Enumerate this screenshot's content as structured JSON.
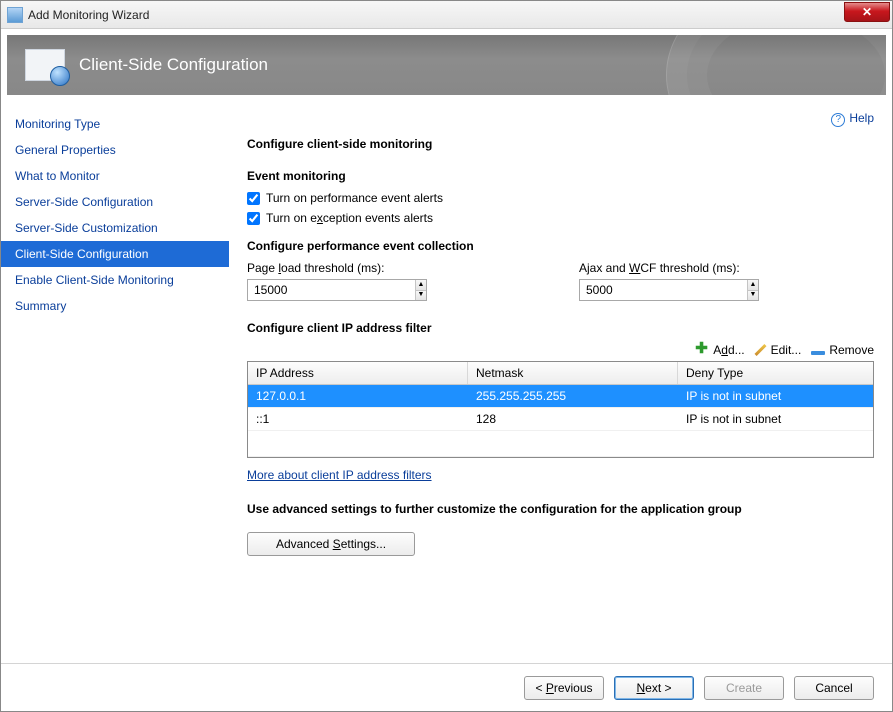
{
  "window": {
    "title": "Add Monitoring Wizard"
  },
  "banner": {
    "caption": "Client-Side Configuration"
  },
  "help": {
    "label": "Help"
  },
  "sidebar": {
    "items": [
      {
        "label": "Monitoring Type"
      },
      {
        "label": "General Properties"
      },
      {
        "label": "What to Monitor"
      },
      {
        "label": "Server-Side Configuration"
      },
      {
        "label": "Server-Side Customization"
      },
      {
        "label": "Client-Side Configuration"
      },
      {
        "label": "Enable Client-Side Monitoring"
      },
      {
        "label": "Summary"
      }
    ],
    "active_index": 5
  },
  "content": {
    "h1": "Configure client-side monitoring",
    "event_heading": "Event monitoring",
    "perf_checkbox": "Turn on performance event alerts",
    "perf_checkbox_checked": true,
    "exc_prefix": "Turn on e",
    "exc_ul": "x",
    "exc_suffix": "ception events alerts",
    "exc_checkbox_checked": true,
    "perf_collection_heading": "Configure performance event collection",
    "page_load_prefix": "Page ",
    "page_load_ul": "l",
    "page_load_suffix": "oad threshold (ms):",
    "page_load_value": "15000",
    "ajax_prefix": "Ajax and ",
    "ajax_ul": "W",
    "ajax_suffix": "CF threshold (ms):",
    "ajax_value": "5000",
    "ipfilter_heading": "Configure client IP address filter",
    "toolbar": {
      "add_ul": "d",
      "add_prefix": "A",
      "add_suffix": "d...",
      "edit": "Edit...",
      "remove": "Remove"
    },
    "table": {
      "cols": [
        "IP Address",
        "Netmask",
        "Deny Type"
      ],
      "rows": [
        {
          "ip": "127.0.0.1",
          "mask": "255.255.255.255",
          "deny": "IP is not in subnet",
          "selected": true
        },
        {
          "ip": "::1",
          "mask": "128",
          "deny": "IP is not in subnet",
          "selected": false
        }
      ]
    },
    "more_link": "More about client IP address filters",
    "adv_heading": "Use advanced settings to further customize the configuration for the application group",
    "adv_btn_prefix": "Advanced ",
    "adv_btn_ul": "S",
    "adv_btn_suffix": "ettings..."
  },
  "footer": {
    "prev_prefix": "< ",
    "prev_ul": "P",
    "prev_suffix": "revious",
    "next_prefix": "",
    "next_ul": "N",
    "next_suffix": "ext >",
    "create": "Create",
    "cancel": "Cancel"
  }
}
